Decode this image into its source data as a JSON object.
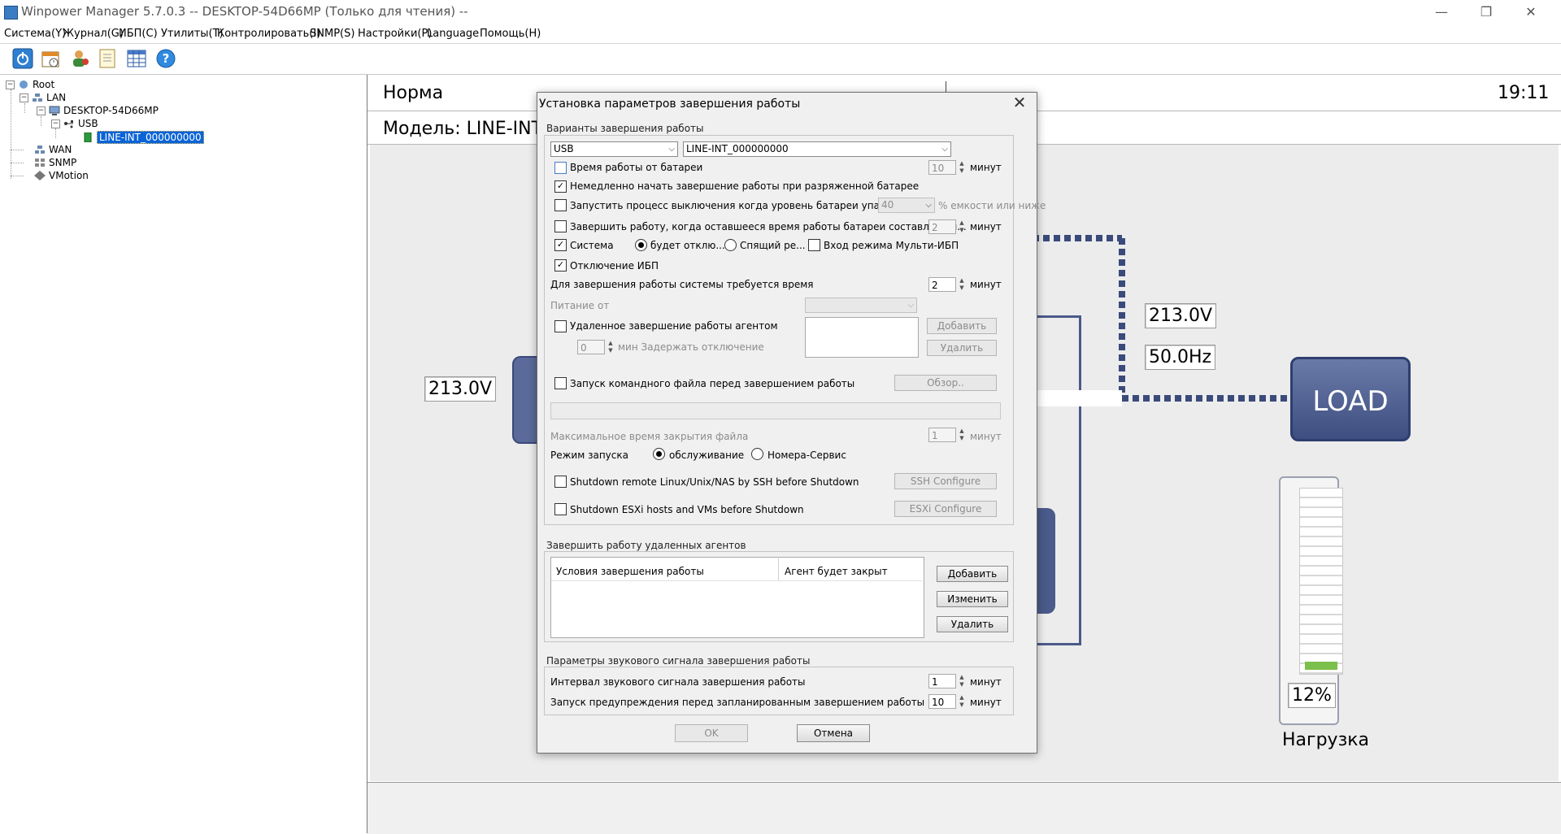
{
  "window": {
    "title": "Winpower Manager 5.7.0.3 -- DESKTOP-54D66MP (Только для чтения) --",
    "minimize": "—",
    "restore": "❐",
    "close": "✕"
  },
  "menu": [
    "Система(Y)",
    "Журнал(G)",
    "ИБП(C)",
    "Утилиты(T)",
    "Контролировать(I)",
    "SNMP(S)",
    "Настройки(P)",
    "Language",
    "Помощь(H)"
  ],
  "toolbar": [
    "power-icon",
    "schedule-icon",
    "user-icon",
    "log-icon",
    "table-icon",
    "help-icon"
  ],
  "tree": {
    "root": "Root",
    "lan": "LAN",
    "host": "DESKTOP-54D66MP",
    "usb": "USB",
    "ups": "LINE-INT_000000000",
    "wan": "WAN",
    "snmp": "SNMP",
    "vmotion": "VMotion"
  },
  "status": {
    "state": "Норма",
    "time": "19:11",
    "model_prefix": "Модель: LINE-INT"
  },
  "diagram": {
    "input_voltage": "213.0V",
    "output_voltage": "213.0V",
    "output_freq": "50.0Hz",
    "load_button": "LOAD",
    "load_percent": "12%",
    "load_level": 0.12,
    "load_label": "Нагрузка"
  },
  "dialog": {
    "title": "Установка параметров завершения работы",
    "close": "✕",
    "options_group": "Варианты завершения работы",
    "port_select": "USB",
    "device_select": "LINE-INT_000000000",
    "battery_time_label": "Время работы от батареи",
    "battery_time_value": "10",
    "minutes": "минут",
    "low_battery_label": "Немедленно начать завершение работы при разряженной батарее",
    "battery_level_label": "Запустить процесс выключения когда уровень батареи упадет до",
    "battery_level_value": "40",
    "battery_level_suffix": "% емкости или ниже",
    "remaining_time_label": "Завершить работу, когда оставшееся время работы батареи составляет м...",
    "remaining_time_value": "2",
    "system_label": "Система",
    "radio_shutdown": "будет отклю...",
    "radio_sleep": "Спящий ре...",
    "multi_ups_label": "Вход режима Мульти-ИБП",
    "ups_off_label": "Отключение ИБП",
    "shutdown_time_label": "Для завершения работы системы требуется время",
    "shutdown_time_value": "2",
    "power_from_label": "Питание от",
    "remote_agent_label": "Удаленное завершение работы агентом",
    "add_button": "Добавить",
    "delete_button": "Удалить",
    "delay_value": "0",
    "delay_label": "мин Задержать отключение",
    "cmd_file_label": "Запуск командного файла перед завершением работы",
    "browse_button": "Обзор..",
    "max_close_label": "Максимальное время закрытия файла",
    "max_close_value": "1",
    "start_mode_label": "Режим запуска",
    "radio_service": "обслуживание",
    "radio_number_service": "Номера-Сервис",
    "ssh_label": "Shutdown remote Linux/Unix/NAS by SSH before Shutdown",
    "ssh_button": "SSH Configure",
    "esxi_label": "Shutdown ESXi hosts and VMs before Shutdown",
    "esxi_button": "ESXi Configure",
    "remote_group": "Завершить работу удаленных агентов",
    "col_conditions": "Условия завершения работы",
    "col_agent": "Агент будет закрыт",
    "remote_add": "Добавить",
    "remote_edit": "Изменить",
    "remote_delete": "Удалить",
    "sound_group": "Параметры звукового сигнала завершения работы",
    "beep_interval_label": "Интервал звукового сигнала завершения работы",
    "beep_interval_value": "1",
    "warn_label": "Запуск предупреждения перед запланированным завершением работы",
    "warn_value": "10",
    "ok_button": "OK",
    "cancel_button": "Отмена"
  }
}
